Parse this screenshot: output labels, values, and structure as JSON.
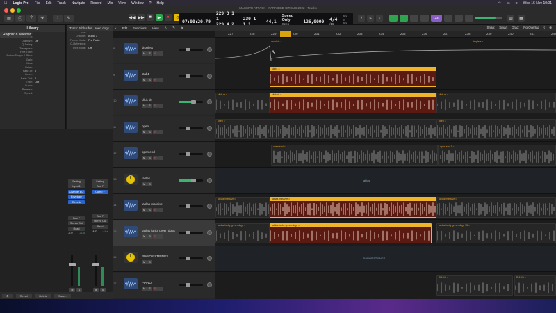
{
  "menubar": {
    "apple": "",
    "items": [
      "Logic Pro",
      "File",
      "Edit",
      "Track",
      "Navigate",
      "Record",
      "Mix",
      "View",
      "Window",
      "?",
      "Help"
    ],
    "clock": "Wed 16 Nov 10:01"
  },
  "window": {
    "title": "MASSIVE ATTACK - PARADISE CIRCUS 2022 - Tracks"
  },
  "lcd": {
    "smpte": "07:00:20.79",
    "bars_top": "229  3  1    1",
    "bars_bottom": "229  4  2  211",
    "bars2_top": "230  1  1    1",
    "sample_rate": "44,1",
    "mode": "Speed Only",
    "mode_sub": "Keep Tempo",
    "tempo": "126,0000",
    "sig_top": "4/4",
    "sig_bottom": "/16",
    "in": "No In",
    "out": "No Out",
    "badge": "1234"
  },
  "toolbar": {
    "edit": "Edit",
    "functions": "Functions",
    "view": "View",
    "snap_label": "Snap:",
    "snap_value": "Smart",
    "drag_label": "Drag:",
    "drag_value": "No Overlap"
  },
  "library": {
    "header": "Library",
    "region": "Region: 8 selected",
    "props": [
      {
        "k": "Mute:",
        "v": ""
      },
      {
        "k": "Loop:",
        "v": ""
      },
      {
        "k": "Quantize:",
        "v": "Off"
      },
      {
        "k": "Q-Swing:",
        "v": ""
      },
      {
        "k": "Transpose:",
        "v": ""
      },
      {
        "k": "Fine Tune:",
        "v": ""
      },
      {
        "k": "Follow Tempo & Pitch:",
        "v": ""
      },
      {
        "k": "Gain:",
        "v": ""
      },
      {
        "k": "More",
        "v": ""
      },
      {
        "k": "Delay:",
        "v": ""
      },
      {
        "k": "Fade-In:",
        "v": "0"
      },
      {
        "k": "Curve:",
        "v": ""
      },
      {
        "k": "Fade-Out:",
        "v": "0"
      },
      {
        "k": "Type:",
        "v": "Out"
      },
      {
        "k": "Curve:",
        "v": ""
      },
      {
        "k": "Reverse:",
        "v": ""
      },
      {
        "k": "Speed:",
        "v": ""
      }
    ]
  },
  "track_inspector": {
    "header": "Track: tablas fun...reen dogs",
    "rows": [
      {
        "k": "Icon:",
        "v": ""
      },
      {
        "k": "Channel:",
        "v": "Audio 7"
      },
      {
        "k": "Freeze Mode:",
        "v": "Pre Fader"
      },
      {
        "k": "Q-Reference:",
        "v": ""
      },
      {
        "k": "Flex Mode:",
        "v": "Off"
      }
    ]
  },
  "strips": [
    {
      "eq": "Setting",
      "io": "Input 1",
      "sends": [
        "Channel EQ",
        "Envelope",
        "Reverb"
      ],
      "bus": "Bus 7",
      "out": "Stereo Out",
      "group": "Read",
      "pan": "-2,0",
      "level": "-11,5",
      "name": "tablas fun...een dogs"
    },
    {
      "eq": "Setting",
      "io": "Bus 7",
      "sends": [
        "Comp +"
      ],
      "bus": "Bus 7",
      "out": "Stereo Out",
      "group": "Read",
      "pan": "-1,9",
      "level": "-10,2",
      "name": "tablas"
    }
  ],
  "bottom": {
    "revert": "Revert",
    "delete": "Delete",
    "save": "Save..."
  },
  "ruler": [
    "227",
    "228",
    "229",
    "230",
    "231",
    "232",
    "233",
    "234",
    "235",
    "236",
    "237",
    "238",
    "239",
    "240",
    "241",
    "242"
  ],
  "tracks": [
    {
      "num": "8",
      "name": "droplets",
      "type": "audio"
    },
    {
      "num": "9",
      "name": "stab1",
      "type": "audio"
    },
    {
      "num": "10",
      "name": "click dr",
      "type": "audio"
    },
    {
      "num": "11",
      "name": "open",
      "type": "audio"
    },
    {
      "num": "12",
      "name": "open end",
      "type": "audio"
    },
    {
      "num": "13",
      "name": "tablas",
      "type": "folder"
    },
    {
      "num": "14",
      "name": "tablas massive",
      "type": "audio"
    },
    {
      "num": "15",
      "name": "tablas funky green dogs",
      "type": "audio"
    },
    {
      "num": "16",
      "name": "PIANOS STRINGS",
      "type": "folder"
    },
    {
      "num": "17",
      "name": "PIANO",
      "type": "audio"
    }
  ],
  "ms_labels": {
    "m": "M",
    "s": "S",
    "r": "R",
    "i": "I"
  },
  "regions": {
    "droplets_a": "droplets ⌂",
    "droplets_b": "droplets ⌂",
    "stab1": "stab1 ⌂",
    "click_a": "click dr ⌂",
    "click_b": "click dr ⌂",
    "click_c": "click dr ⌂",
    "open_a": "open ⌂",
    "open_b": "open ⌂",
    "openend_a": "open end ⌂",
    "openend_b": "open end 1 ⌂",
    "tablas_folder": "tablas",
    "tablas_massive_a": "tablas massive ⌂",
    "tablas_massive_b": "tablas massive ⌂",
    "tablas_green_a": "tablas funky green dogs ⌂",
    "tablas_green_b": "tablas funky green dogs 78 ⌂",
    "pianos_folder": "PIANOS STRINGS",
    "piano_a": "PIANO ⌂",
    "piano_b": "PIANO ⌂"
  },
  "colors": {
    "selected_region": "#f0b429",
    "region_body": "#5a1a12",
    "audio_wave": "#aaaaaa",
    "folder_accent": "#e6c200"
  }
}
